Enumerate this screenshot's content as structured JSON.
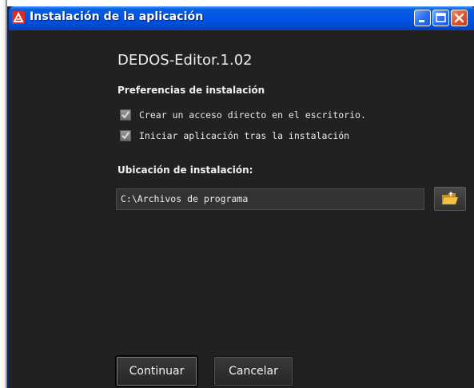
{
  "window": {
    "title": "Instalación de la aplicación",
    "titlebar_color": "#0055e5",
    "icons": {
      "app": "adobe-air-icon",
      "minimize": "minimize-icon",
      "maximize": "maximize-icon",
      "close": "close-icon"
    }
  },
  "app": {
    "name": "DEDOS-Editor.1.02"
  },
  "preferences": {
    "title": "Preferencias de instalación",
    "options": [
      {
        "label": "Crear un acceso directo en el escritorio.",
        "checked": true
      },
      {
        "label": "Iniciar aplicación tras la instalación",
        "checked": true
      }
    ]
  },
  "location": {
    "title": "Ubicación de instalación:",
    "path": "C:\\Archivos de programa",
    "browse_icon": "folder-open-icon"
  },
  "actions": {
    "continue_label": "Continuar",
    "cancel_label": "Cancelar"
  },
  "colors": {
    "background": "#212121",
    "text": "#ececec"
  }
}
